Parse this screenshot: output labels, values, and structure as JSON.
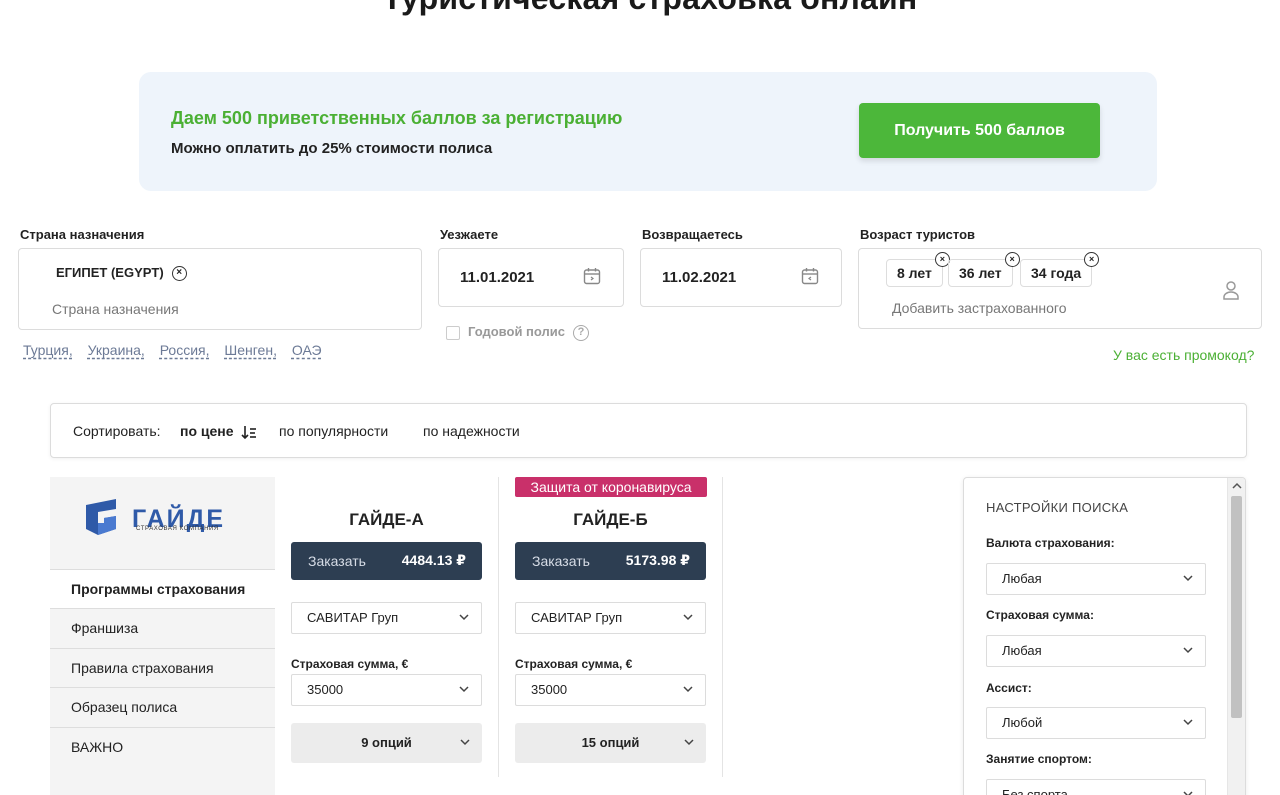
{
  "page": {
    "title": "Туристическая страховка онлайн"
  },
  "promo": {
    "title": "Даем 500 приветственных баллов за регистрацию",
    "subtitle": "Можно оплатить до 25% стоимости полиса",
    "button": "Получить 500 баллов"
  },
  "search": {
    "country": {
      "label": "Страна назначения",
      "selected": "ЕГИПЕТ (EGYPT)",
      "placeholder": "Страна назначения",
      "quick_links": [
        "Турция,",
        "Украина,",
        "Россия,",
        "Шенген,",
        "ОАЭ"
      ]
    },
    "depart": {
      "label": "Уезжаете",
      "value": "11.01.2021"
    },
    "return": {
      "label": "Возвращаетесь",
      "value": "11.02.2021"
    },
    "annual_policy": "Годовой полис",
    "ages": {
      "label": "Возраст туристов",
      "chips": [
        "8 лет",
        "36 лет",
        "34 года"
      ],
      "add_placeholder": "Добавить застрахованного"
    },
    "promo_code_link": "У вас есть промокод?"
  },
  "sort": {
    "label": "Сортировать:",
    "options": [
      "по цене",
      "по популярности",
      "по надежности"
    ]
  },
  "company": {
    "logo_name": "ГАЙДЕ",
    "logo_sub": "СТРАХОВАЯ КОМПАНИЯ",
    "menu": [
      "Программы страхования",
      "Франшиза",
      "Правила страхования",
      "Образец полиса",
      "ВАЖНО"
    ]
  },
  "products": [
    {
      "name": "ГАЙДЕ-А",
      "badge": "",
      "order_label": "Заказать",
      "price": "4484.13 ₽",
      "assist": "САВИТАР Груп",
      "sum_label": "Страховая сумма, €",
      "sum": "35000",
      "options": "9 опций"
    },
    {
      "name": "ГАЙДЕ-Б",
      "badge": "Защита от коронавируса",
      "order_label": "Заказать",
      "price": "5173.98 ₽",
      "assist": "САВИТАР Груп",
      "sum_label": "Страховая сумма, €",
      "sum": "35000",
      "options": "15 опций"
    }
  ],
  "settings": {
    "title": "Настройки поиска",
    "fields": [
      {
        "label": "Валюта страхования:",
        "value": "Любая"
      },
      {
        "label": "Страховая сумма:",
        "value": "Любая"
      },
      {
        "label": "Ассист:",
        "value": "Любой"
      },
      {
        "label": "Занятие спортом:",
        "value": "Без спорта"
      }
    ]
  },
  "colors": {
    "accent_green": "#4cb73a",
    "dark_button": "#2d3e52",
    "badge": "#c9306a",
    "logo_blue": "#2f5aa8"
  }
}
